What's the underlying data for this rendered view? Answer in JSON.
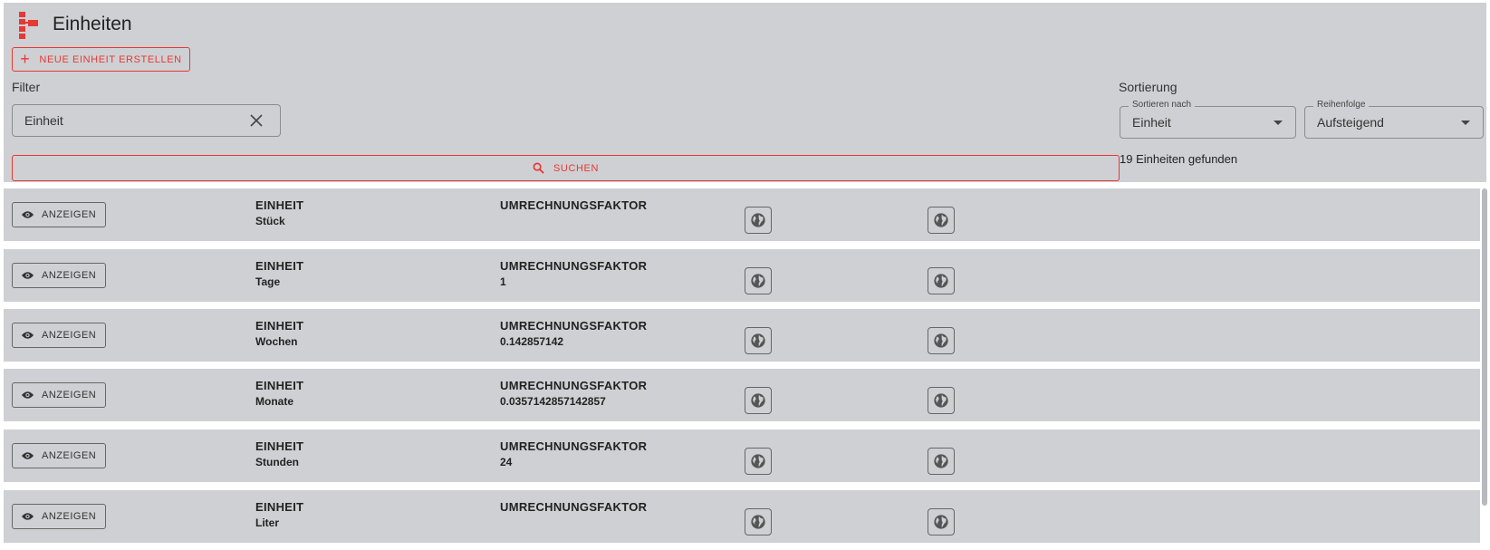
{
  "header": {
    "title": "Einheiten",
    "new_button": "NEUE EINHEIT ERSTELLEN",
    "filter_label": "Filter",
    "filter_value": "Einheit",
    "search_button": "SUCHEN",
    "sort_label": "Sortierung",
    "sort_by_legend": "Sortieren nach",
    "sort_by_value": "Einheit",
    "order_legend": "Reihenfolge",
    "order_value": "Aufsteigend",
    "result_count": "19 Einheiten gefunden"
  },
  "icons": {
    "logo": "app-logo-icon",
    "plus": "plus-icon",
    "clear": "close-icon",
    "search": "search-icon",
    "eye": "eye-icon",
    "globe": "globe-icon"
  },
  "colors": {
    "accent": "#e53935",
    "panel": "#cfd0d4"
  },
  "list": {
    "show_label": "ANZEIGEN",
    "unit_header": "EINHEIT",
    "factor_header": "UMRECHNUNGSFAKTOR",
    "rows": [
      {
        "unit": "Stück",
        "factor": ""
      },
      {
        "unit": "Tage",
        "factor": "1"
      },
      {
        "unit": "Wochen",
        "factor": "0.142857142"
      },
      {
        "unit": "Monate",
        "factor": "0.0357142857142857"
      },
      {
        "unit": "Stunden",
        "factor": "24"
      },
      {
        "unit": "Liter",
        "factor": ""
      }
    ]
  }
}
